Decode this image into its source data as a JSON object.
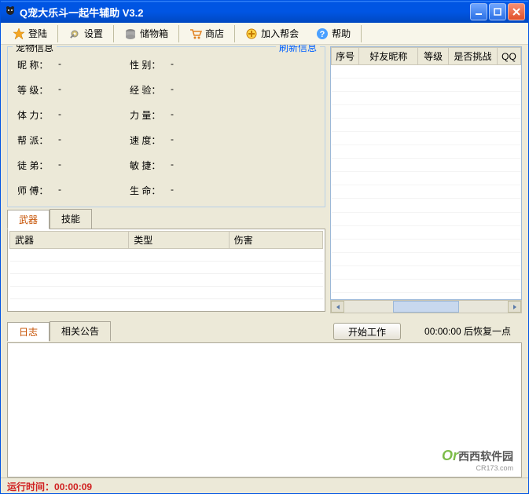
{
  "window": {
    "title": "Q宠大乐斗一起牛辅助  V3.2"
  },
  "toolbar": {
    "login": "登陆",
    "settings": "设置",
    "storage": "储物箱",
    "shop": "商店",
    "join_guild": "加入帮会",
    "help": "帮助"
  },
  "petinfo": {
    "legend": "宠物信息",
    "refresh": "刷新信息",
    "labels": {
      "nickname": "昵  称：",
      "gender": "性  别：",
      "level": "等  级：",
      "exp": "经  验：",
      "stamina": "体  力：",
      "power": "力  量：",
      "guild": "帮  派：",
      "speed": "速  度：",
      "apprentice": "徒  弟：",
      "agility": "敏  捷：",
      "master": "师  傅：",
      "life": "生  命："
    },
    "values": {
      "nickname": "-",
      "gender": "-",
      "level": "-",
      "exp": "-",
      "stamina": "-",
      "power": "-",
      "guild": "-",
      "speed": "-",
      "apprentice": "-",
      "agility": "-",
      "master": "-",
      "life": "-"
    }
  },
  "equip_tabs": {
    "weapon": "武器",
    "skill": "技能"
  },
  "weapon_cols": {
    "name": "武器",
    "type": "类型",
    "damage": "伤害"
  },
  "friend_cols": {
    "seq": "序号",
    "nickname": "好友昵称",
    "level": "等级",
    "challenge": "是否挑战",
    "qq": "QQ"
  },
  "log_tabs": {
    "log": "日志",
    "notice": "相关公告"
  },
  "action": {
    "start": "开始工作",
    "countdown": "00:00:00 后恢复一点"
  },
  "status": {
    "runtime_label": "运行时间：",
    "runtime_value": "00:00:09"
  },
  "watermark": {
    "brand": "Or",
    "text": "西西软件园",
    "url": "CR173.com"
  }
}
